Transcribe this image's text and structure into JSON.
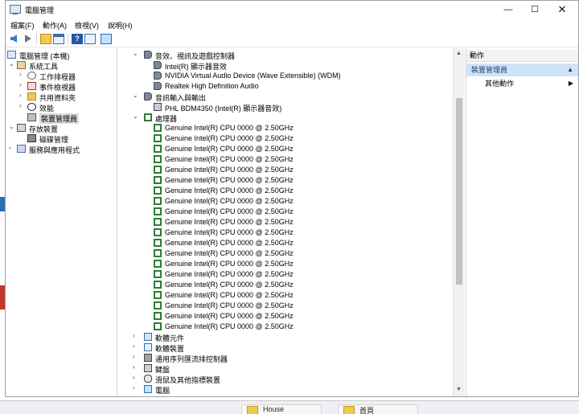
{
  "window": {
    "title": "電腦管理",
    "controls": {
      "minimize": "—",
      "maximize": "☐",
      "close": "✕"
    }
  },
  "menu": [
    "檔案(F)",
    "動作(A)",
    "檢視(V)",
    "說明(H)"
  ],
  "toolbar": {
    "buttons": [
      "back-icon",
      "forward-icon",
      "up-folder-icon",
      "show-hide-tree-icon",
      "help-icon",
      "properties-icon",
      "monitor-icon"
    ]
  },
  "tree": {
    "root": "電腦管理 (本機)",
    "system_tools": "系統工具",
    "task_scheduler": "工作排程器",
    "event_viewer": "事件檢視器",
    "shared_folders": "共用資料夾",
    "performance": "效能",
    "device_manager": "裝置管理員",
    "storage": "存放裝置",
    "disk_management": "磁碟管理",
    "services_apps": "服務與應用程式"
  },
  "devices": {
    "audio_category": "音效、視訊及遊戲控制器",
    "audio_items": [
      "Intel(R) 顯示器音效",
      "NVIDIA Virtual Audio Device (Wave Extensible) (WDM)",
      "Realtek High Definition Audio"
    ],
    "audio_io_category": "音訊輸入與輸出",
    "audio_io_items": [
      "PHL BDM4350 (Intel(R) 顯示器音效)"
    ],
    "processor_category": "處理器",
    "processors": [
      "Genuine Intel(R) CPU 0000 @ 2.50GHz",
      "Genuine Intel(R) CPU 0000 @ 2.50GHz",
      "Genuine Intel(R) CPU 0000 @ 2.50GHz",
      "Genuine Intel(R) CPU 0000 @ 2.50GHz",
      "Genuine Intel(R) CPU 0000 @ 2.50GHz",
      "Genuine Intel(R) CPU 0000 @ 2.50GHz",
      "Genuine Intel(R) CPU 0000 @ 2.50GHz",
      "Genuine Intel(R) CPU 0000 @ 2.50GHz",
      "Genuine Intel(R) CPU 0000 @ 2.50GHz",
      "Genuine Intel(R) CPU 0000 @ 2.50GHz",
      "Genuine Intel(R) CPU 0000 @ 2.50GHz",
      "Genuine Intel(R) CPU 0000 @ 2.50GHz",
      "Genuine Intel(R) CPU 0000 @ 2.50GHz",
      "Genuine Intel(R) CPU 0000 @ 2.50GHz",
      "Genuine Intel(R) CPU 0000 @ 2.50GHz",
      "Genuine Intel(R) CPU 0000 @ 2.50GHz",
      "Genuine Intel(R) CPU 0000 @ 2.50GHz",
      "Genuine Intel(R) CPU 0000 @ 2.50GHz",
      "Genuine Intel(R) CPU 0000 @ 2.50GHz",
      "Genuine Intel(R) CPU 0000 @ 2.50GHz"
    ],
    "collapsed_categories": [
      "軟體元件",
      "軟體裝置",
      "通用序列匯流排控制器",
      "鍵盤",
      "滑鼠及其他指標裝置",
      "電腦"
    ]
  },
  "actions": {
    "header": "動作",
    "section": "裝置管理員",
    "more": "其他動作"
  },
  "taskbar": [
    "House",
    "首頁"
  ]
}
